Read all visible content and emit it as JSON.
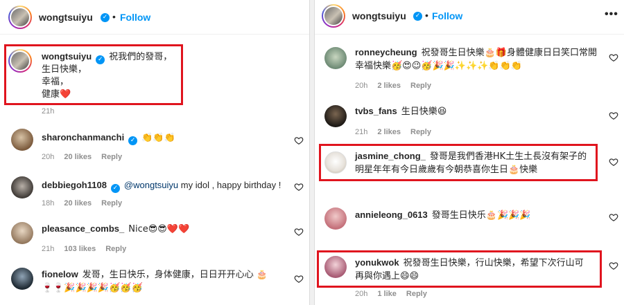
{
  "left": {
    "header": {
      "username": "wongtsuiyu",
      "separator": "•",
      "follow": "Follow"
    },
    "caption": {
      "username": "wongtsuiyu",
      "lines": [
        "祝我們的發哥，",
        "生日快樂，",
        "幸福，",
        "健康"
      ],
      "heart": "❤️",
      "time": "21h"
    },
    "comments": [
      {
        "username": "sharonchanmanchi",
        "text": "👏👏👏",
        "time": "20h",
        "likes": "20 likes",
        "reply": "Reply"
      },
      {
        "username": "debbiegoh1108",
        "mention": "@wongtsuiyu",
        "text": " my idol , happy birthday !",
        "time": "18h",
        "likes": "20 likes",
        "reply": "Reply"
      },
      {
        "username": "pleasance_combs_",
        "text": "Nice😎😎❤️❤️",
        "time": "21h",
        "likes": "103 likes",
        "reply": "Reply"
      },
      {
        "username": "fionelow",
        "text": "发哥，生日快乐，身体健康，日日开开心心 🎂🍷🍷🎉🎉🎉🎉🥳🥳🥳",
        "time": "",
        "likes": "",
        "reply": ""
      }
    ]
  },
  "right": {
    "header": {
      "username": "wongtsuiyu",
      "separator": "•",
      "follow": "Follow"
    },
    "comments": [
      {
        "username": "ronneycheung",
        "text": "祝發哥生日快樂🎂🎁身體健康日日笑口常開幸福快樂🥳😍😉🥳🎉🎉✨✨✨👏👏👏",
        "time": "20h",
        "likes": "2 likes",
        "reply": "Reply"
      },
      {
        "username": "tvbs_fans",
        "text": "生日快樂😆",
        "time": "21h",
        "likes": "2 likes",
        "reply": "Reply"
      },
      {
        "username": "jasmine_chong_",
        "text": "發哥是我們香港HK土生土長沒有架子的明星年年有今日歲歲有今朝恭喜你生日🎂快樂",
        "time": "",
        "likes": "",
        "reply": ""
      },
      {
        "username": "annieleong_0613",
        "text": "發哥生日快乐🎂🎉🎉🎉",
        "time": "",
        "likes": "",
        "reply": ""
      },
      {
        "username": "yonukwok",
        "text": "祝發哥生日快樂，行山快樂，希望下次行山可再與你遇上😄😄",
        "time": "20h",
        "likes": "1 like",
        "reply": "Reply"
      }
    ]
  },
  "colors": {
    "accent": "#0095f6",
    "highlight": "#e0141e",
    "meta": "#8e8e8e"
  },
  "icons": {
    "verified": "verified-badge-icon",
    "like": "heart-outline-icon",
    "more": "more-options-icon"
  }
}
